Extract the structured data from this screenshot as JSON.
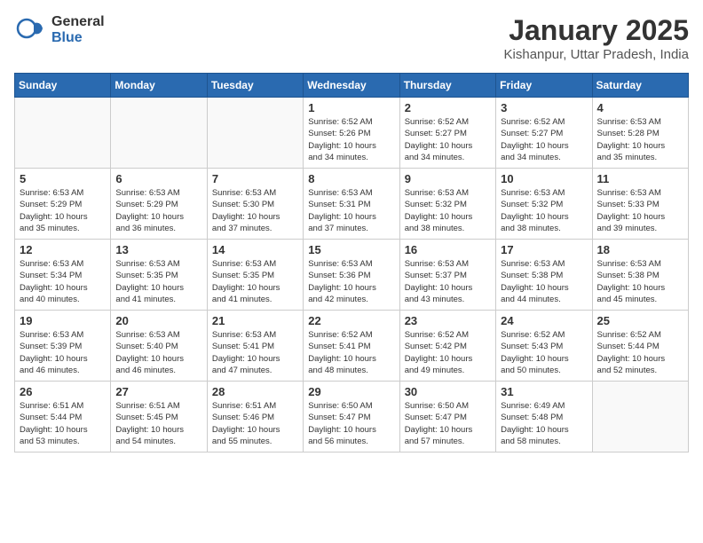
{
  "header": {
    "logo_general": "General",
    "logo_blue": "Blue",
    "title": "January 2025",
    "subtitle": "Kishanpur, Uttar Pradesh, India"
  },
  "weekdays": [
    "Sunday",
    "Monday",
    "Tuesday",
    "Wednesday",
    "Thursday",
    "Friday",
    "Saturday"
  ],
  "weeks": [
    [
      {
        "day": "",
        "info": ""
      },
      {
        "day": "",
        "info": ""
      },
      {
        "day": "",
        "info": ""
      },
      {
        "day": "1",
        "info": "Sunrise: 6:52 AM\nSunset: 5:26 PM\nDaylight: 10 hours\nand 34 minutes."
      },
      {
        "day": "2",
        "info": "Sunrise: 6:52 AM\nSunset: 5:27 PM\nDaylight: 10 hours\nand 34 minutes."
      },
      {
        "day": "3",
        "info": "Sunrise: 6:52 AM\nSunset: 5:27 PM\nDaylight: 10 hours\nand 34 minutes."
      },
      {
        "day": "4",
        "info": "Sunrise: 6:53 AM\nSunset: 5:28 PM\nDaylight: 10 hours\nand 35 minutes."
      }
    ],
    [
      {
        "day": "5",
        "info": "Sunrise: 6:53 AM\nSunset: 5:29 PM\nDaylight: 10 hours\nand 35 minutes."
      },
      {
        "day": "6",
        "info": "Sunrise: 6:53 AM\nSunset: 5:29 PM\nDaylight: 10 hours\nand 36 minutes."
      },
      {
        "day": "7",
        "info": "Sunrise: 6:53 AM\nSunset: 5:30 PM\nDaylight: 10 hours\nand 37 minutes."
      },
      {
        "day": "8",
        "info": "Sunrise: 6:53 AM\nSunset: 5:31 PM\nDaylight: 10 hours\nand 37 minutes."
      },
      {
        "day": "9",
        "info": "Sunrise: 6:53 AM\nSunset: 5:32 PM\nDaylight: 10 hours\nand 38 minutes."
      },
      {
        "day": "10",
        "info": "Sunrise: 6:53 AM\nSunset: 5:32 PM\nDaylight: 10 hours\nand 38 minutes."
      },
      {
        "day": "11",
        "info": "Sunrise: 6:53 AM\nSunset: 5:33 PM\nDaylight: 10 hours\nand 39 minutes."
      }
    ],
    [
      {
        "day": "12",
        "info": "Sunrise: 6:53 AM\nSunset: 5:34 PM\nDaylight: 10 hours\nand 40 minutes."
      },
      {
        "day": "13",
        "info": "Sunrise: 6:53 AM\nSunset: 5:35 PM\nDaylight: 10 hours\nand 41 minutes."
      },
      {
        "day": "14",
        "info": "Sunrise: 6:53 AM\nSunset: 5:35 PM\nDaylight: 10 hours\nand 41 minutes."
      },
      {
        "day": "15",
        "info": "Sunrise: 6:53 AM\nSunset: 5:36 PM\nDaylight: 10 hours\nand 42 minutes."
      },
      {
        "day": "16",
        "info": "Sunrise: 6:53 AM\nSunset: 5:37 PM\nDaylight: 10 hours\nand 43 minutes."
      },
      {
        "day": "17",
        "info": "Sunrise: 6:53 AM\nSunset: 5:38 PM\nDaylight: 10 hours\nand 44 minutes."
      },
      {
        "day": "18",
        "info": "Sunrise: 6:53 AM\nSunset: 5:38 PM\nDaylight: 10 hours\nand 45 minutes."
      }
    ],
    [
      {
        "day": "19",
        "info": "Sunrise: 6:53 AM\nSunset: 5:39 PM\nDaylight: 10 hours\nand 46 minutes."
      },
      {
        "day": "20",
        "info": "Sunrise: 6:53 AM\nSunset: 5:40 PM\nDaylight: 10 hours\nand 46 minutes."
      },
      {
        "day": "21",
        "info": "Sunrise: 6:53 AM\nSunset: 5:41 PM\nDaylight: 10 hours\nand 47 minutes."
      },
      {
        "day": "22",
        "info": "Sunrise: 6:52 AM\nSunset: 5:41 PM\nDaylight: 10 hours\nand 48 minutes."
      },
      {
        "day": "23",
        "info": "Sunrise: 6:52 AM\nSunset: 5:42 PM\nDaylight: 10 hours\nand 49 minutes."
      },
      {
        "day": "24",
        "info": "Sunrise: 6:52 AM\nSunset: 5:43 PM\nDaylight: 10 hours\nand 50 minutes."
      },
      {
        "day": "25",
        "info": "Sunrise: 6:52 AM\nSunset: 5:44 PM\nDaylight: 10 hours\nand 52 minutes."
      }
    ],
    [
      {
        "day": "26",
        "info": "Sunrise: 6:51 AM\nSunset: 5:44 PM\nDaylight: 10 hours\nand 53 minutes."
      },
      {
        "day": "27",
        "info": "Sunrise: 6:51 AM\nSunset: 5:45 PM\nDaylight: 10 hours\nand 54 minutes."
      },
      {
        "day": "28",
        "info": "Sunrise: 6:51 AM\nSunset: 5:46 PM\nDaylight: 10 hours\nand 55 minutes."
      },
      {
        "day": "29",
        "info": "Sunrise: 6:50 AM\nSunset: 5:47 PM\nDaylight: 10 hours\nand 56 minutes."
      },
      {
        "day": "30",
        "info": "Sunrise: 6:50 AM\nSunset: 5:47 PM\nDaylight: 10 hours\nand 57 minutes."
      },
      {
        "day": "31",
        "info": "Sunrise: 6:49 AM\nSunset: 5:48 PM\nDaylight: 10 hours\nand 58 minutes."
      },
      {
        "day": "",
        "info": ""
      }
    ]
  ]
}
